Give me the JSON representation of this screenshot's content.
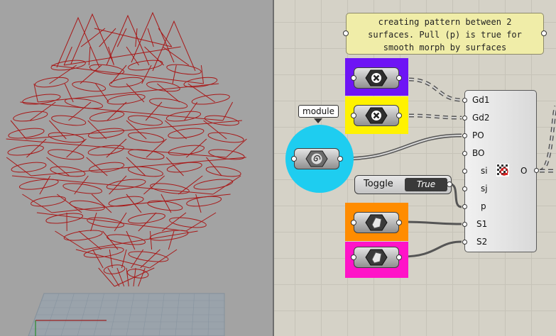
{
  "note": {
    "lines": [
      "creating pattern between 2",
      "surfaces. Pull (p) is true for",
      "smooth morph by surfaces"
    ]
  },
  "tooltip": {
    "label": "module"
  },
  "toggle": {
    "label": "Toggle",
    "value": "True"
  },
  "component": {
    "inputs": [
      "Gd1",
      "Gd2",
      "PO",
      "BO",
      "si",
      "sj",
      "p",
      "S1",
      "S2"
    ],
    "output": "O"
  },
  "groups": {
    "purple": "#6e14f5",
    "yellow": "#fff200",
    "orange": "#ff8c00",
    "magenta": "#ff14c8",
    "cyan": "#1ecdf0"
  },
  "icons": {
    "geometry_params": [
      "cross-hex-icon",
      "cross-hex-icon"
    ],
    "module_param": "spiral-hex-icon",
    "surface_params": [
      "surface-hex-icon",
      "surface-hex-icon"
    ],
    "component": "pattern-grid-icon"
  }
}
